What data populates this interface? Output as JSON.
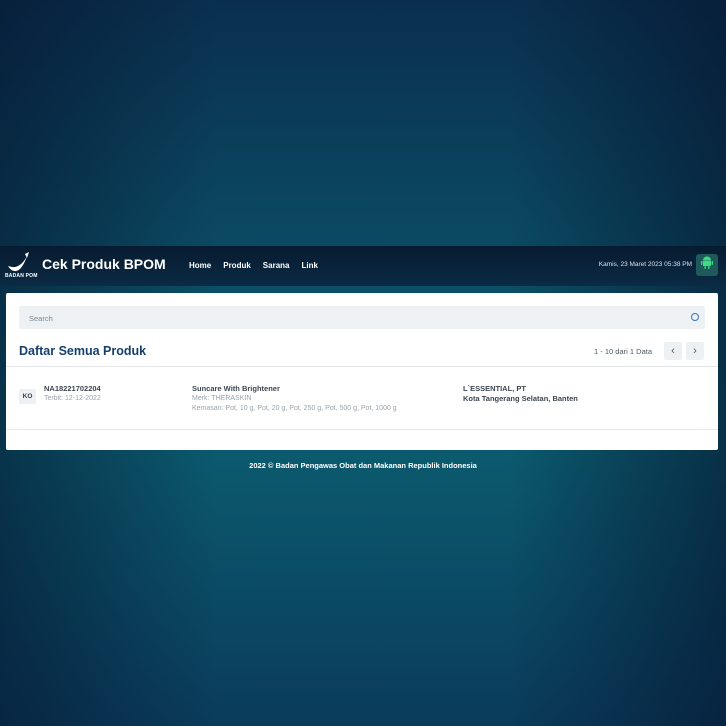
{
  "brand": {
    "title": "Cek Produk BPOM",
    "logo_caption": "BADAN POM"
  },
  "nav": {
    "items": [
      "Home",
      "Produk",
      "Sarana",
      "Link"
    ]
  },
  "header": {
    "datetime": "Kamis, 23 Maret 2023 05:38 PM",
    "app_icon": "android-icon"
  },
  "search": {
    "placeholder": "Search",
    "value": "",
    "icon": "search-icon"
  },
  "listing": {
    "title": "Daftar Semua Produk",
    "range_start": "1",
    "range_dash": "-",
    "range_end": "10",
    "of_label": "dari",
    "total": "1",
    "unit": "Data"
  },
  "products": [
    {
      "category": "KO",
      "reg_no": "NA18221702204",
      "issued": "Terbit: 12-12-2022",
      "name": "Suncare With Brightener",
      "brand": "Merk: THERASKIN",
      "packaging": "Kemasan: Pot, 10 g, Pot, 20 g, Pot, 250 g, Pot, 500 g, Pot, 1000 g",
      "company": "L`ESSENTIAL, PT",
      "location": "Kota Tangerang Selatan, Banten"
    }
  ],
  "footer": {
    "text": "2022 ©  Badan Pengawas Obat dan Makanan Republik Indonesia"
  },
  "colors": {
    "navbar": "#0b2a44",
    "title": "#163e6e",
    "android": "#3ddc84"
  }
}
